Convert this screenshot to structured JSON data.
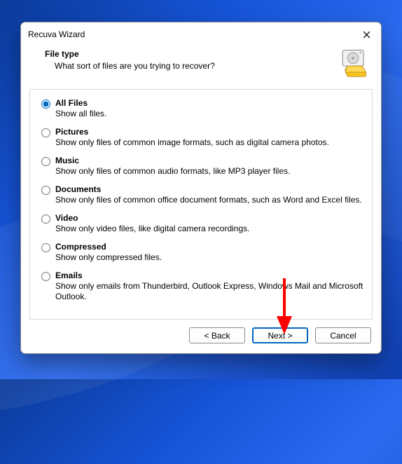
{
  "window": {
    "title": "Recuva Wizard"
  },
  "header": {
    "title": "File type",
    "subtitle": "What sort of files are you trying to recover?"
  },
  "options": [
    {
      "id": "all",
      "title": "All Files",
      "desc": "Show all files.",
      "selected": true
    },
    {
      "id": "pictures",
      "title": "Pictures",
      "desc": "Show only files of common image formats, such as digital camera photos.",
      "selected": false
    },
    {
      "id": "music",
      "title": "Music",
      "desc": "Show only files of common audio formats, like MP3 player files.",
      "selected": false
    },
    {
      "id": "documents",
      "title": "Documents",
      "desc": "Show only files of common office document formats, such as Word and Excel files.",
      "selected": false
    },
    {
      "id": "video",
      "title": "Video",
      "desc": "Show only video files, like digital camera recordings.",
      "selected": false
    },
    {
      "id": "compressed",
      "title": "Compressed",
      "desc": "Show only compressed files.",
      "selected": false
    },
    {
      "id": "emails",
      "title": "Emails",
      "desc": "Show only emails from Thunderbird, Outlook Express, Windows Mail and Microsoft Outlook.",
      "selected": false
    }
  ],
  "buttons": {
    "back": "< Back",
    "next": "Next >",
    "cancel": "Cancel"
  }
}
